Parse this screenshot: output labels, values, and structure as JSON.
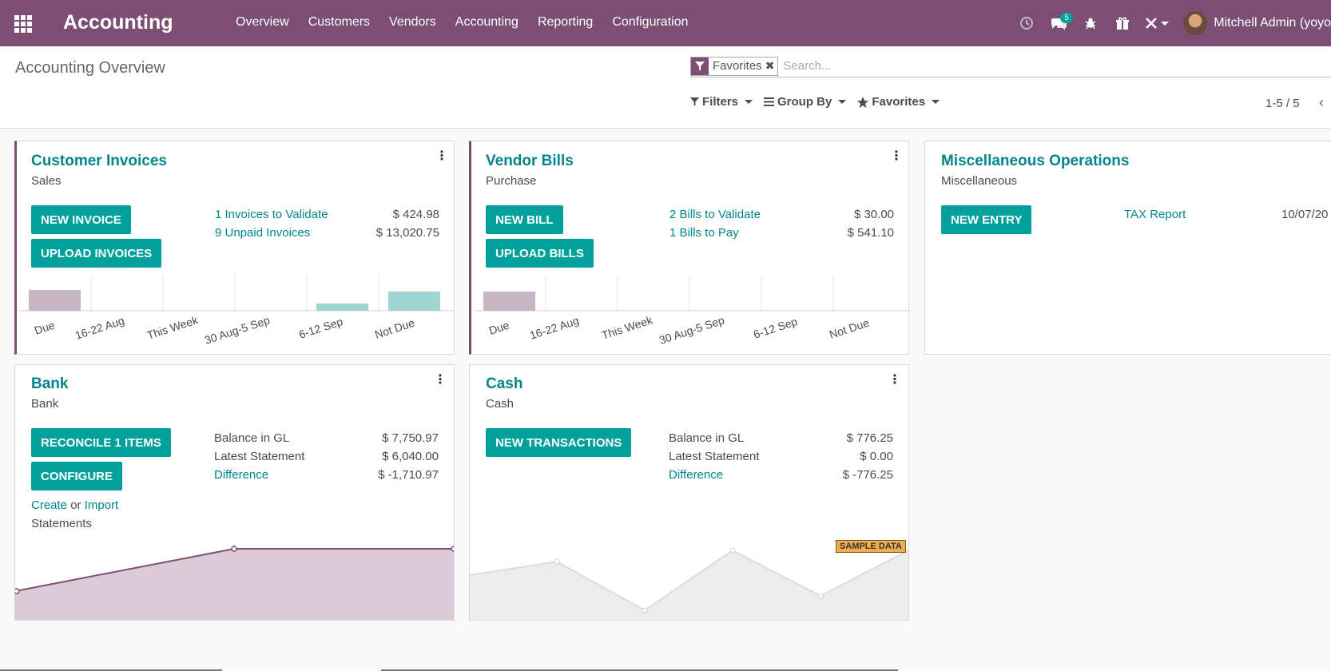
{
  "navbar": {
    "brand": "Accounting",
    "menu": [
      "Overview",
      "Customers",
      "Vendors",
      "Accounting",
      "Reporting",
      "Configuration"
    ],
    "messages_badge": "5",
    "user_name": "Mitchell Admin (yoyo"
  },
  "control_panel": {
    "title": "Accounting Overview",
    "facet_label": "Favorites",
    "search_placeholder": "Search...",
    "filters_label": "Filters",
    "groupby_label": "Group By",
    "favorites_label": "Favorites",
    "pager": "1-5 / 5"
  },
  "cards": {
    "customer_invoices": {
      "title": "Customer Invoices",
      "subtitle": "Sales",
      "btn_primary": "New Invoice",
      "btn_secondary": "Upload Invoices",
      "link1": "1 Invoices to Validate",
      "amount1": "$ 424.98",
      "link2": "9 Unpaid Invoices",
      "amount2": "$ 13,020.75",
      "chart_labels": [
        "Due",
        "16-22 Aug",
        "This Week",
        "30 Aug-5 Sep",
        "6-12 Sep",
        "Not Due"
      ]
    },
    "vendor_bills": {
      "title": "Vendor Bills",
      "subtitle": "Purchase",
      "btn_primary": "New Bill",
      "btn_secondary": "Upload Bills",
      "link1": "2 Bills to Validate",
      "amount1": "$ 30.00",
      "link2": "1 Bills to Pay",
      "amount2": "$ 541.10",
      "chart_labels": [
        "Due",
        "16-22 Aug",
        "This Week",
        "30 Aug-5 Sep",
        "6-12 Sep",
        "Not Due"
      ]
    },
    "misc": {
      "title": "Miscellaneous Operations",
      "subtitle": "Miscellaneous",
      "btn_primary": "New Entry",
      "link1": "TAX Report",
      "date": "10/07/20"
    },
    "bank": {
      "title": "Bank",
      "subtitle": "Bank",
      "btn_primary": "Reconcile 1 Items",
      "btn_secondary": "Configure",
      "balance_label": "Balance in GL",
      "balance": "$ 7,750.97",
      "statement_label": "Latest Statement",
      "statement": "$ 6,040.00",
      "difference_label": "Difference",
      "difference": "$ -1,710.97",
      "create_label": "Create",
      "or_label": "or",
      "import_label": "Import",
      "statements_label": "Statements"
    },
    "cash": {
      "title": "Cash",
      "subtitle": "Cash",
      "btn_primary": "New Transactions",
      "balance_label": "Balance in GL",
      "balance": "$ 776.25",
      "statement_label": "Latest Statement",
      "statement": "$ 0.00",
      "difference_label": "Difference",
      "difference": "$ -776.25",
      "sample_badge": "SAMPLE DATA"
    }
  },
  "colors": {
    "navbar": "#7c4e73",
    "primary": "#00a09d",
    "link": "#00868a",
    "due_bar": "#c7b6c3",
    "future_bar": "#9fd6d2"
  }
}
